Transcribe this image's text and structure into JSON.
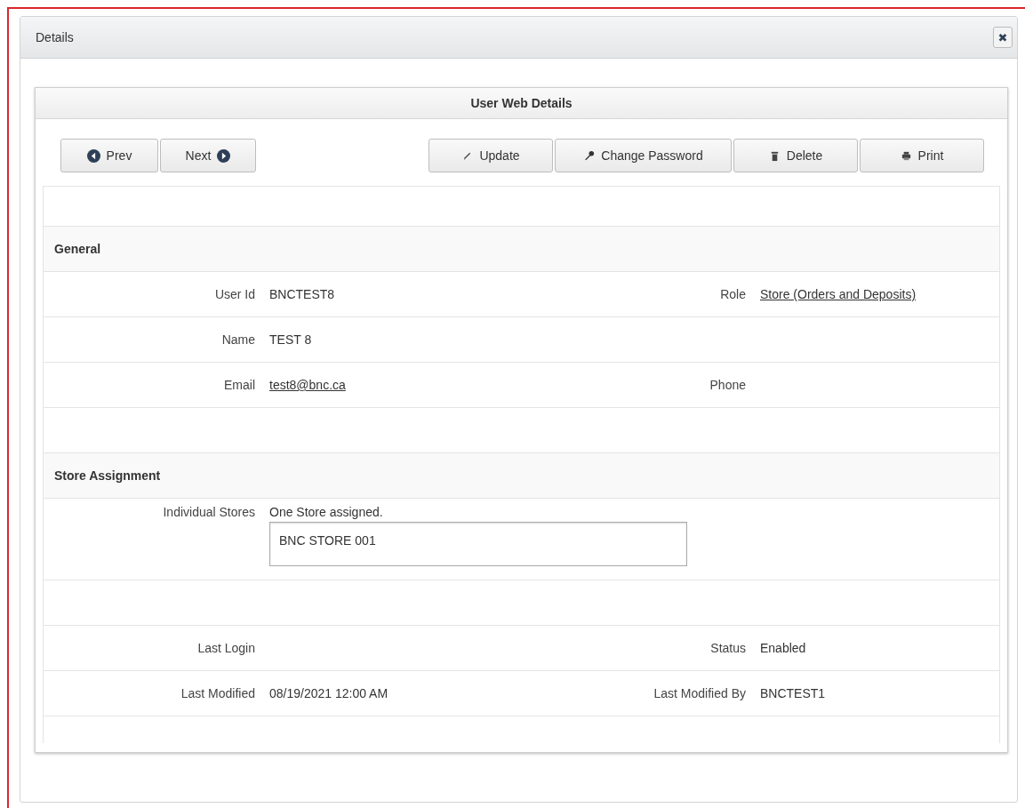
{
  "window": {
    "title": "Details",
    "close": "✖"
  },
  "panel": {
    "title": "User Web Details"
  },
  "nav_buttons": [
    {
      "label": "Prev"
    },
    {
      "label": "Next"
    }
  ],
  "action_buttons": [
    {
      "label": "Update"
    },
    {
      "label": "Change Password"
    },
    {
      "label": "Delete"
    },
    {
      "label": "Print"
    }
  ],
  "rows": [
    {
      "kind": "spacer"
    },
    {
      "kind": "section",
      "title": "General"
    },
    {
      "kind": "fields",
      "fields": [
        {
          "label": "User Id",
          "value": "BNCTEST8",
          "link": false
        },
        {
          "label": "Role",
          "value": "Store (Orders and Deposits)",
          "link": true
        }
      ]
    },
    {
      "kind": "fields",
      "fields": [
        {
          "label": "Name",
          "value": "TEST 8",
          "link": false
        }
      ]
    },
    {
      "kind": "fields",
      "fields": [
        {
          "label": "Email",
          "value": "test8@bnc.ca",
          "link": true
        },
        {
          "label": "Phone"
        }
      ]
    },
    {
      "kind": "spacer"
    },
    {
      "kind": "section",
      "title": "Store Assignment"
    },
    {
      "kind": "stores",
      "label": "Individual Stores",
      "summary": "One Store assigned.",
      "stores": [
        "BNC STORE 001"
      ]
    },
    {
      "kind": "spacer"
    },
    {
      "kind": "fields",
      "fields": [
        {
          "label": "Last Login"
        },
        {
          "label": "Status",
          "value": "Enabled",
          "link": false
        }
      ]
    },
    {
      "kind": "fields",
      "fields": [
        {
          "label": "Last Modified",
          "value": "08/19/2021 12:00 AM",
          "link": false
        },
        {
          "label": "Last Modified By",
          "value": "BNCTEST1",
          "link": false
        }
      ]
    },
    {
      "kind": "spacer"
    }
  ]
}
